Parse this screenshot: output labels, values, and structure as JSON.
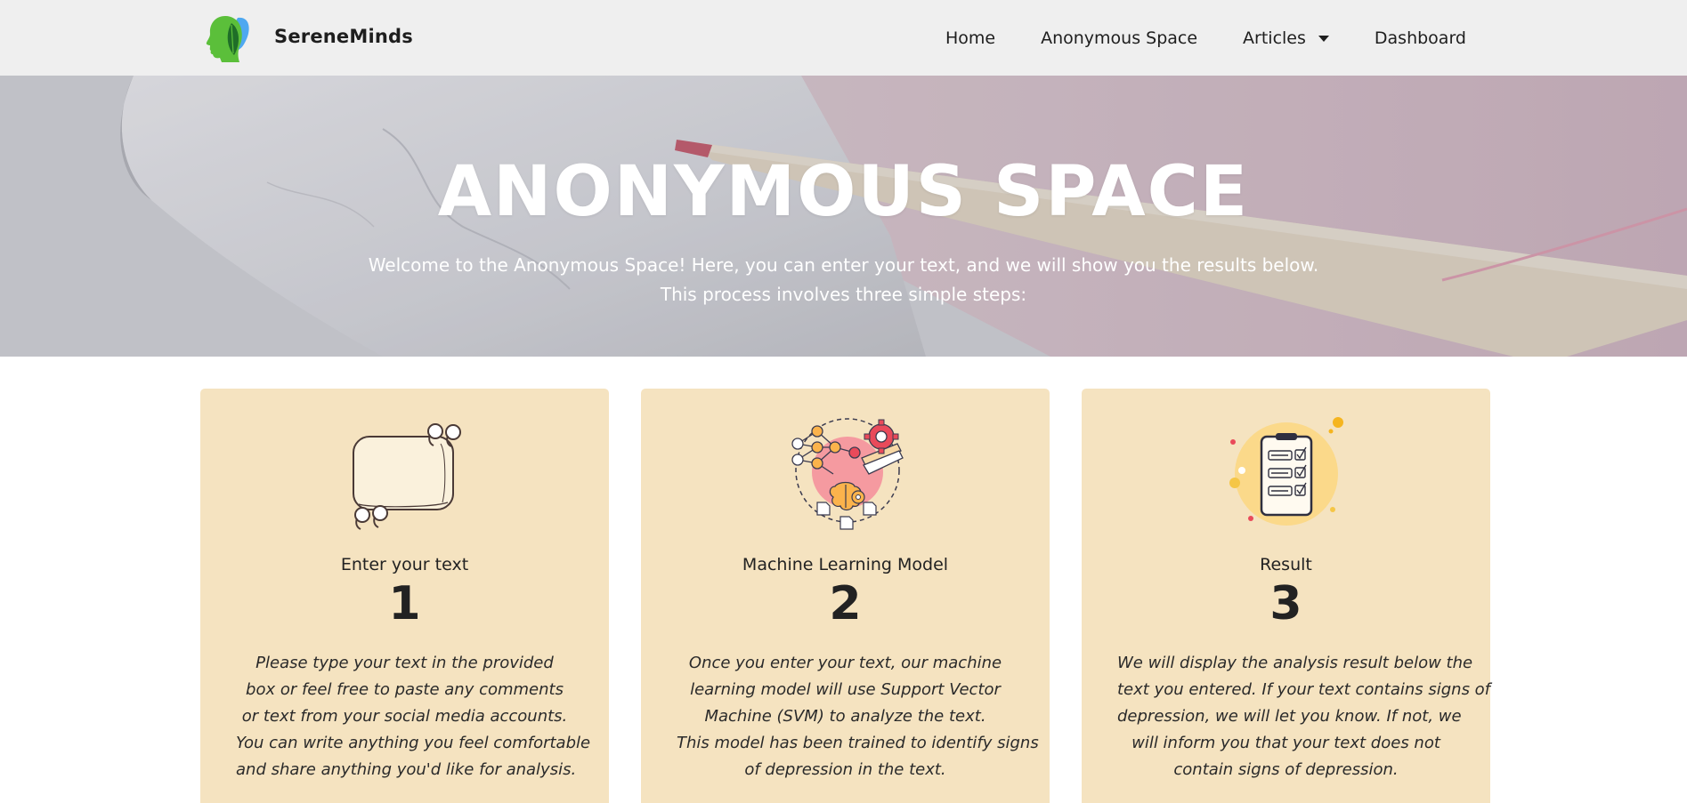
{
  "navbar": {
    "brand": "SereneMinds",
    "links": [
      {
        "label": "Home"
      },
      {
        "label": "Anonymous Space"
      },
      {
        "label": "Articles"
      },
      {
        "label": "Dashboard"
      }
    ]
  },
  "hero": {
    "title": "ANONYMOUS SPACE",
    "subtitle_line1": "Welcome to the Anonymous Space! Here, you can enter your text, and we will show you the results below.",
    "subtitle_line2": "This process involves three simple steps:"
  },
  "steps": [
    {
      "icon": "speech-bubble-icon",
      "label": "Enter your text",
      "number": "1",
      "description_lines": [
        "Please type your text in the provided",
        "box or feel free to paste any comments",
        "or text from your social media accounts.",
        "You can write anything you feel comfortable",
        "and share anything you'd like for analysis."
      ]
    },
    {
      "icon": "machine-learning-icon",
      "label": "Machine Learning Model",
      "number": "2",
      "description_lines": [
        "Once you enter your text, our machine",
        "learning model will use Support Vector",
        "Machine (SVM) to analyze the text.",
        "This model has been trained to identify signs",
        "of depression in the text."
      ]
    },
    {
      "icon": "checklist-result-icon",
      "label": "Result",
      "number": "3",
      "description_lines": [
        "We will display the analysis result below the",
        "text you entered. If your text contains signs of",
        "depression, we will let you know. If not, we",
        "will inform you that your text does not",
        "contain signs of depression."
      ]
    }
  ],
  "colors": {
    "navbar_bg": "#efefef",
    "card_bg": "#f5e3c0",
    "logo_green": "#5bbf3a",
    "logo_blue": "#4ea8f0"
  }
}
